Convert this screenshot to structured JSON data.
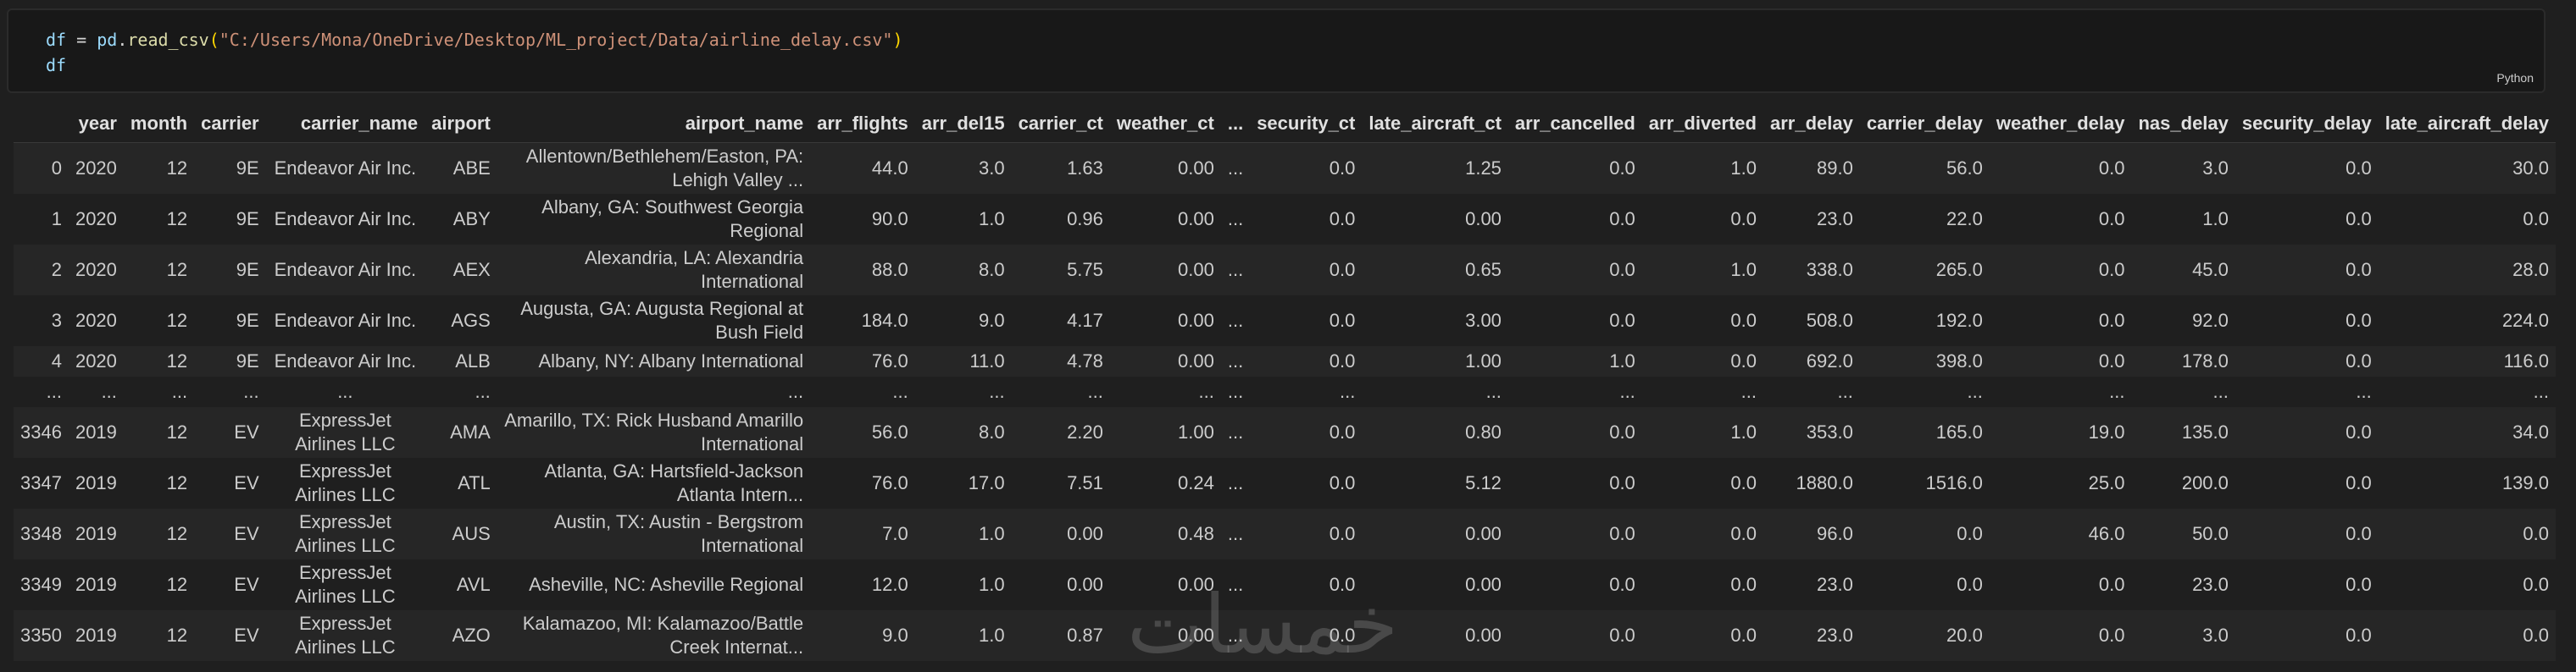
{
  "cell": {
    "code_lines": [
      {
        "var": "df",
        "op": " = ",
        "obj": "pd",
        "dot": ".",
        "fn": "read_csv",
        "open": "(",
        "str": "\"C:/Users/Mona/OneDrive/Desktop/ML_project/Data/airline_delay.csv\"",
        "close": ")"
      },
      {
        "var": "df"
      }
    ],
    "language": "Python"
  },
  "table": {
    "columns": [
      "",
      "year",
      "month",
      "carrier",
      "carrier_name",
      "airport",
      "airport_name",
      "arr_flights",
      "arr_del15",
      "carrier_ct",
      "weather_ct",
      "...",
      "security_ct",
      "late_aircraft_ct",
      "arr_cancelled",
      "arr_diverted",
      "arr_delay",
      "carrier_delay",
      "weather_delay",
      "nas_delay",
      "security_delay",
      "late_aircraft_delay"
    ],
    "rows": [
      [
        "0",
        "2020",
        "12",
        "9E",
        "Endeavor Air Inc.",
        "ABE",
        "Allentown/Bethlehem/Easton, PA: Lehigh Valley ...",
        "44.0",
        "3.0",
        "1.63",
        "0.00",
        "...",
        "0.0",
        "1.25",
        "0.0",
        "1.0",
        "89.0",
        "56.0",
        "0.0",
        "3.0",
        "0.0",
        "30.0"
      ],
      [
        "1",
        "2020",
        "12",
        "9E",
        "Endeavor Air Inc.",
        "ABY",
        "Albany, GA: Southwest Georgia Regional",
        "90.0",
        "1.0",
        "0.96",
        "0.00",
        "...",
        "0.0",
        "0.00",
        "0.0",
        "0.0",
        "23.0",
        "22.0",
        "0.0",
        "1.0",
        "0.0",
        "0.0"
      ],
      [
        "2",
        "2020",
        "12",
        "9E",
        "Endeavor Air Inc.",
        "AEX",
        "Alexandria, LA: Alexandria International",
        "88.0",
        "8.0",
        "5.75",
        "0.00",
        "...",
        "0.0",
        "0.65",
        "0.0",
        "1.0",
        "338.0",
        "265.0",
        "0.0",
        "45.0",
        "0.0",
        "28.0"
      ],
      [
        "3",
        "2020",
        "12",
        "9E",
        "Endeavor Air Inc.",
        "AGS",
        "Augusta, GA: Augusta Regional at Bush Field",
        "184.0",
        "9.0",
        "4.17",
        "0.00",
        "...",
        "0.0",
        "3.00",
        "0.0",
        "0.0",
        "508.0",
        "192.0",
        "0.0",
        "92.0",
        "0.0",
        "224.0"
      ],
      [
        "4",
        "2020",
        "12",
        "9E",
        "Endeavor Air Inc.",
        "ALB",
        "Albany, NY: Albany International",
        "76.0",
        "11.0",
        "4.78",
        "0.00",
        "...",
        "0.0",
        "1.00",
        "1.0",
        "0.0",
        "692.0",
        "398.0",
        "0.0",
        "178.0",
        "0.0",
        "116.0"
      ],
      [
        "...",
        "...",
        "...",
        "...",
        "...",
        "...",
        "...",
        "...",
        "...",
        "...",
        "...",
        "...",
        "...",
        "...",
        "...",
        "...",
        "...",
        "...",
        "...",
        "...",
        "...",
        "..."
      ],
      [
        "3346",
        "2019",
        "12",
        "EV",
        "ExpressJet Airlines LLC",
        "AMA",
        "Amarillo, TX: Rick Husband Amarillo International",
        "56.0",
        "8.0",
        "2.20",
        "1.00",
        "...",
        "0.0",
        "0.80",
        "0.0",
        "1.0",
        "353.0",
        "165.0",
        "19.0",
        "135.0",
        "0.0",
        "34.0"
      ],
      [
        "3347",
        "2019",
        "12",
        "EV",
        "ExpressJet Airlines LLC",
        "ATL",
        "Atlanta, GA: Hartsfield-Jackson Atlanta Intern...",
        "76.0",
        "17.0",
        "7.51",
        "0.24",
        "...",
        "0.0",
        "5.12",
        "0.0",
        "0.0",
        "1880.0",
        "1516.0",
        "25.0",
        "200.0",
        "0.0",
        "139.0"
      ],
      [
        "3348",
        "2019",
        "12",
        "EV",
        "ExpressJet Airlines LLC",
        "AUS",
        "Austin, TX: Austin - Bergstrom International",
        "7.0",
        "1.0",
        "0.00",
        "0.48",
        "...",
        "0.0",
        "0.00",
        "0.0",
        "0.0",
        "96.0",
        "0.0",
        "46.0",
        "50.0",
        "0.0",
        "0.0"
      ],
      [
        "3349",
        "2019",
        "12",
        "EV",
        "ExpressJet Airlines LLC",
        "AVL",
        "Asheville, NC: Asheville Regional",
        "12.0",
        "1.0",
        "0.00",
        "0.00",
        "...",
        "0.0",
        "0.00",
        "0.0",
        "0.0",
        "23.0",
        "0.0",
        "0.0",
        "23.0",
        "0.0",
        "0.0"
      ],
      [
        "3350",
        "2019",
        "12",
        "EV",
        "ExpressJet Airlines LLC",
        "AZO",
        "Kalamazoo, MI: Kalamazoo/Battle Creek Internat...",
        "9.0",
        "1.0",
        "0.87",
        "0.00",
        "...",
        "0.0",
        "0.00",
        "0.0",
        "0.0",
        "23.0",
        "20.0",
        "0.0",
        "3.0",
        "0.0",
        "0.0"
      ]
    ]
  },
  "watermark": {
    "text": "خمسات"
  }
}
